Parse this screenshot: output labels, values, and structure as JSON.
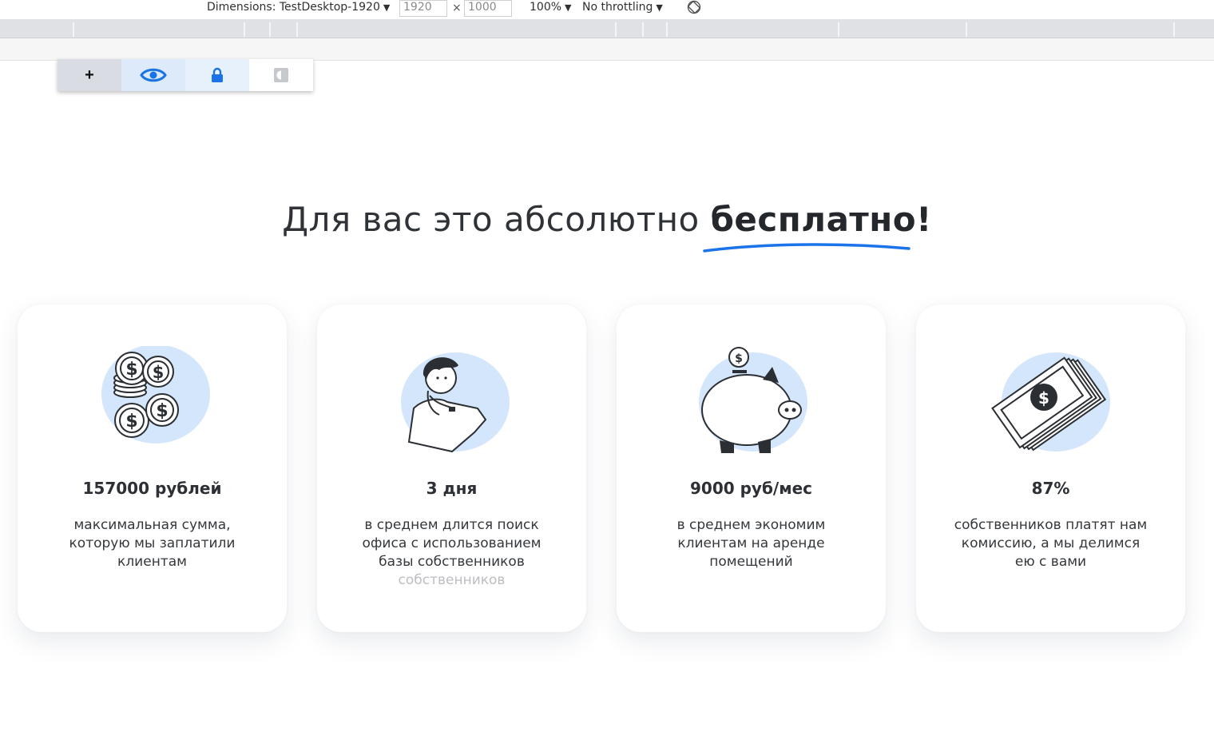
{
  "devtools": {
    "dimensions_label": "Dimensions: TestDesktop-1920",
    "width_value": "1920",
    "height_value": "1000",
    "times": "×",
    "zoom": "100%",
    "throttling": "No throttling",
    "caret": "▼"
  },
  "widget": {
    "plus_label": "+",
    "accent_color": "#1a73e8"
  },
  "heading": {
    "normal": "Для вас это абсолютно ",
    "bold": "бесплатно!"
  },
  "cards": [
    {
      "illustration": "coins-icon",
      "stat": "157000 рублей",
      "description": "максимальная сумма, которую мы заплатили клиентам"
    },
    {
      "illustration": "thinking-person-icon",
      "stat": "3 дня",
      "description": "в среднем длится поиск офиса с использованием базы собственников",
      "ghost_word": "собственников"
    },
    {
      "illustration": "piggy-bank-icon",
      "stat": "9000 руб/мес",
      "description": "в среднем экономим клиентам на аренде помещений"
    },
    {
      "illustration": "money-bills-icon",
      "stat": "87%",
      "description": "собственников платят нам комиссию, а мы делимся ею с вами"
    }
  ]
}
